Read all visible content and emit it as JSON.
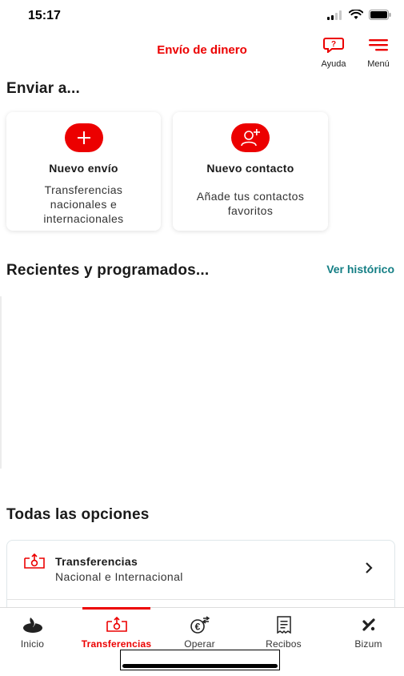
{
  "status_bar": {
    "time": "15:17"
  },
  "header": {
    "title": "Envío de dinero",
    "help_label": "Ayuda",
    "menu_label": "Menú",
    "help_icon": "chat-help-icon",
    "menu_icon": "hamburger-icon"
  },
  "send_section": {
    "title": "Enviar a...",
    "cards": [
      {
        "icon": "plus-icon",
        "title": "Nuevo envío",
        "description": "Transferencias nacionales e internacionales"
      },
      {
        "icon": "add-contact-icon",
        "title": "Nuevo contacto",
        "description": "Añade tus contactos favoritos"
      }
    ]
  },
  "recent_section": {
    "title": "Recientes y programados...",
    "link": "Ver histórico"
  },
  "all_options": {
    "title": "Todas las opciones",
    "items": [
      {
        "icon": "transfer-icon",
        "title": "Transferencias",
        "subtitle": "Nacional e Internacional"
      }
    ]
  },
  "bottom_nav": {
    "items": [
      {
        "label": "Inicio",
        "icon": "santander-flame-icon"
      },
      {
        "label": "Transferencias",
        "icon": "transfer-icon",
        "active": true
      },
      {
        "label": "Operar",
        "icon": "euro-exchange-icon"
      },
      {
        "label": "Recibos",
        "icon": "receipt-icon"
      },
      {
        "label": "Bizum",
        "icon": "bizum-icon"
      }
    ]
  },
  "colors": {
    "brand_red": "#ec0000",
    "link_teal": "#137e84"
  }
}
